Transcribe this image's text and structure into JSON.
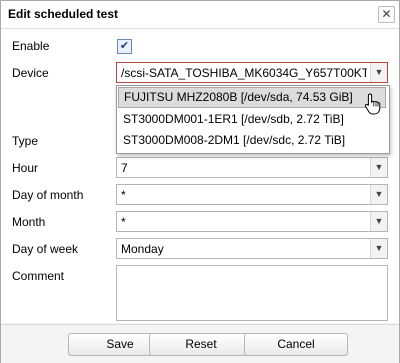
{
  "dialog": {
    "title": "Edit scheduled test"
  },
  "form": {
    "enable_label": "Enable",
    "enable_checked": true,
    "device_label": "Device",
    "device_value": "/scsi-SATA_TOSHIBA_MK6034G_Y657T00KT",
    "device_options": [
      "FUJITSU MHZ2080B [/dev/sda, 74.53 GiB]",
      "ST3000DM001-1ER1 [/dev/sdb, 2.72 TiB]",
      "ST3000DM008-2DM1 [/dev/sdc, 2.72 TiB]"
    ],
    "type_label": "Type",
    "hour_label": "Hour",
    "hour_value": "7",
    "day_of_month_label": "Day of month",
    "day_of_month_value": "*",
    "month_label": "Month",
    "month_value": "*",
    "day_of_week_label": "Day of week",
    "day_of_week_value": "Monday",
    "comment_label": "Comment",
    "comment_value": ""
  },
  "buttons": {
    "save": "Save",
    "reset": "Reset",
    "cancel": "Cancel"
  },
  "icons": {
    "close": "close-icon",
    "arrow": "chevron-down-icon",
    "cursor": "hand-pointer-icon",
    "check": "checkmark-icon"
  },
  "colors": {
    "device_border": "#b84a3c",
    "checkbox_accent": "#1c3e8a",
    "highlight": "#dcdcdc"
  }
}
